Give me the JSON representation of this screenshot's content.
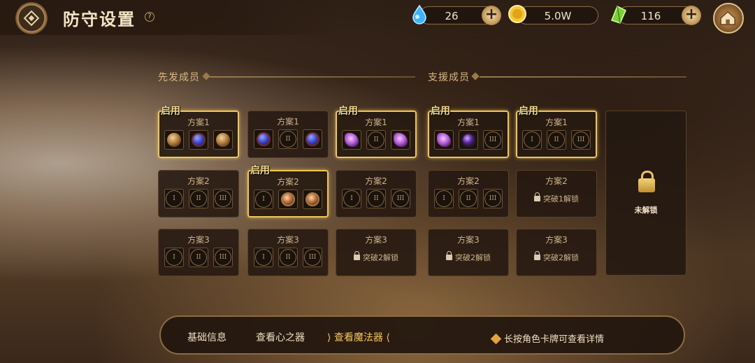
{
  "header": {
    "title": "防守设置",
    "help": "?"
  },
  "resources": [
    {
      "name": "water-drop",
      "value": "26"
    },
    {
      "name": "gold-coin",
      "value": "5.0W"
    },
    {
      "name": "green-crystal",
      "value": "116"
    }
  ],
  "sections": {
    "starters": "先发成员",
    "support": "支援成员"
  },
  "labels": {
    "enabled": "启用",
    "locked": "未解锁",
    "roman": [
      "I",
      "II",
      "III"
    ]
  },
  "columns": [
    {
      "cards": [
        {
          "name": "方案1",
          "active": true,
          "slots": [
            "bronze",
            "blue",
            "bronze"
          ]
        },
        {
          "name": "方案2",
          "active": false,
          "slots": [
            "I",
            "II",
            "III"
          ]
        },
        {
          "name": "方案3",
          "active": false,
          "slots": [
            "I",
            "II",
            "III"
          ]
        }
      ]
    },
    {
      "cards": [
        {
          "name": "方案1",
          "active": false,
          "slots": [
            "blue",
            "II",
            "blue"
          ]
        },
        {
          "name": "方案2",
          "active": true,
          "slots": [
            "I",
            "orb",
            "orb"
          ]
        },
        {
          "name": "方案3",
          "active": false,
          "slots": [
            "I",
            "II",
            "III"
          ]
        }
      ]
    },
    {
      "cards": [
        {
          "name": "方案1",
          "active": true,
          "slots": [
            "purple",
            "II",
            "purple"
          ]
        },
        {
          "name": "方案2",
          "active": false,
          "slots": [
            "I",
            "II",
            "III"
          ]
        },
        {
          "name": "方案3",
          "active": false,
          "lock": "突破2解锁"
        }
      ]
    },
    {
      "cards": [
        {
          "name": "方案1",
          "active": true,
          "slots": [
            "purple",
            "violet",
            "III"
          ]
        },
        {
          "name": "方案2",
          "active": false,
          "slots": [
            "I",
            "II",
            "III"
          ]
        },
        {
          "name": "方案3",
          "active": false,
          "lock": "突破2解锁"
        }
      ]
    },
    {
      "cards": [
        {
          "name": "方案1",
          "active": true,
          "slots": [
            "I",
            "II",
            "III"
          ]
        },
        {
          "name": "方案2",
          "active": false,
          "lock": "突破1解锁"
        },
        {
          "name": "方案3",
          "active": false,
          "lock": "突破2解锁"
        }
      ]
    }
  ],
  "bottom": {
    "tabs": [
      "基础信息",
      "查看心之器",
      "查看魔法器"
    ],
    "selected_tab": 2,
    "hint": "长按角色卡牌可查看详情"
  },
  "colors": {
    "active_border": "#f0c65a",
    "selected_tab": "#f3c760"
  }
}
